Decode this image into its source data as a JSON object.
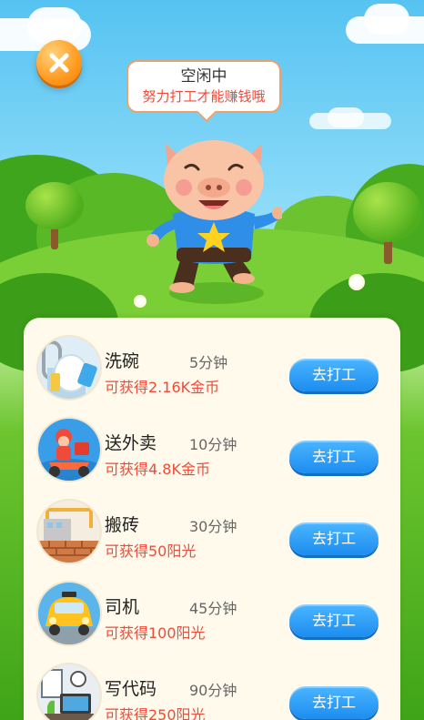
{
  "bubble": {
    "status": "空闲中",
    "hint": "努力打工才能赚钱哦"
  },
  "jobs": [
    {
      "name": "洗碗",
      "duration": "5分钟",
      "reward": "可获得2.16K金币",
      "button": "去打工",
      "icon": "dishwashing-icon"
    },
    {
      "name": "送外卖",
      "duration": "10分钟",
      "reward": "可获得4.8K金币",
      "button": "去打工",
      "icon": "food-delivery-icon"
    },
    {
      "name": "搬砖",
      "duration": "30分钟",
      "reward": "可获得50阳光",
      "button": "去打工",
      "icon": "brick-carrying-icon"
    },
    {
      "name": "司机",
      "duration": "45分钟",
      "reward": "可获得100阳光",
      "button": "去打工",
      "icon": "taxi-driver-icon"
    },
    {
      "name": "写代码",
      "duration": "90分钟",
      "reward": "可获得250阳光",
      "button": "去打工",
      "icon": "coding-icon"
    }
  ],
  "colors": {
    "accent_blue": "#1c8df0",
    "reward_red": "#f04b3a",
    "close_orange": "#ff9a1f",
    "panel_bg": "#fffaec"
  }
}
